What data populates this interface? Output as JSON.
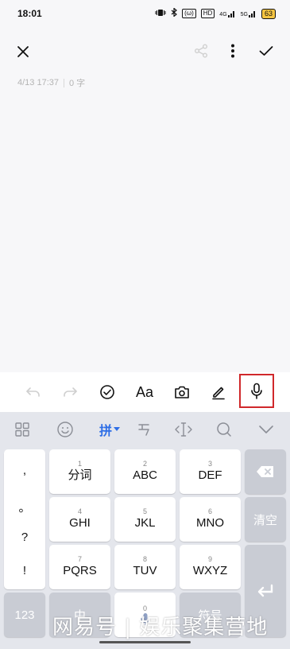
{
  "status_bar": {
    "time": "18:01",
    "icons": [
      "vibrate-icon",
      "bluetooth-icon",
      "wifi-icon",
      "hd-icon",
      "signal-4g-icon",
      "signal-icon",
      "battery-icon"
    ],
    "wifi_label": "(ω)",
    "hd_label": "HD",
    "signal1_label": "4G",
    "signal2_label": "5G",
    "battery": "63"
  },
  "note": {
    "date": "4/13 17:37",
    "char_count": "0 字"
  },
  "toolbar": {
    "font_label": "Aa"
  },
  "keyboard": {
    "top_bar": {
      "pinyin_label": "拼"
    },
    "punctuation": [
      ",",
      "。",
      "?",
      "!"
    ],
    "keys": [
      {
        "num": "1",
        "label": "分词"
      },
      {
        "num": "2",
        "label": "ABC"
      },
      {
        "num": "3",
        "label": "DEF"
      },
      {
        "num": "4",
        "label": "GHI"
      },
      {
        "num": "5",
        "label": "JKL"
      },
      {
        "num": "6",
        "label": "MNO"
      },
      {
        "num": "7",
        "label": "PQRS"
      },
      {
        "num": "8",
        "label": "TUV"
      },
      {
        "num": "9",
        "label": "WXYZ"
      }
    ],
    "clear_label": "清空",
    "numbers_label": "123",
    "zhong_label": "中",
    "zero_label": "0",
    "symbol_label": "符号"
  },
  "watermark": "网易号 | 娱乐聚集营地",
  "colors": {
    "accent": "#2e6ee6",
    "highlight_border": "#d0282b",
    "keyboard_bg": "#e4e6ec",
    "page_bg": "#f7f7f9"
  }
}
